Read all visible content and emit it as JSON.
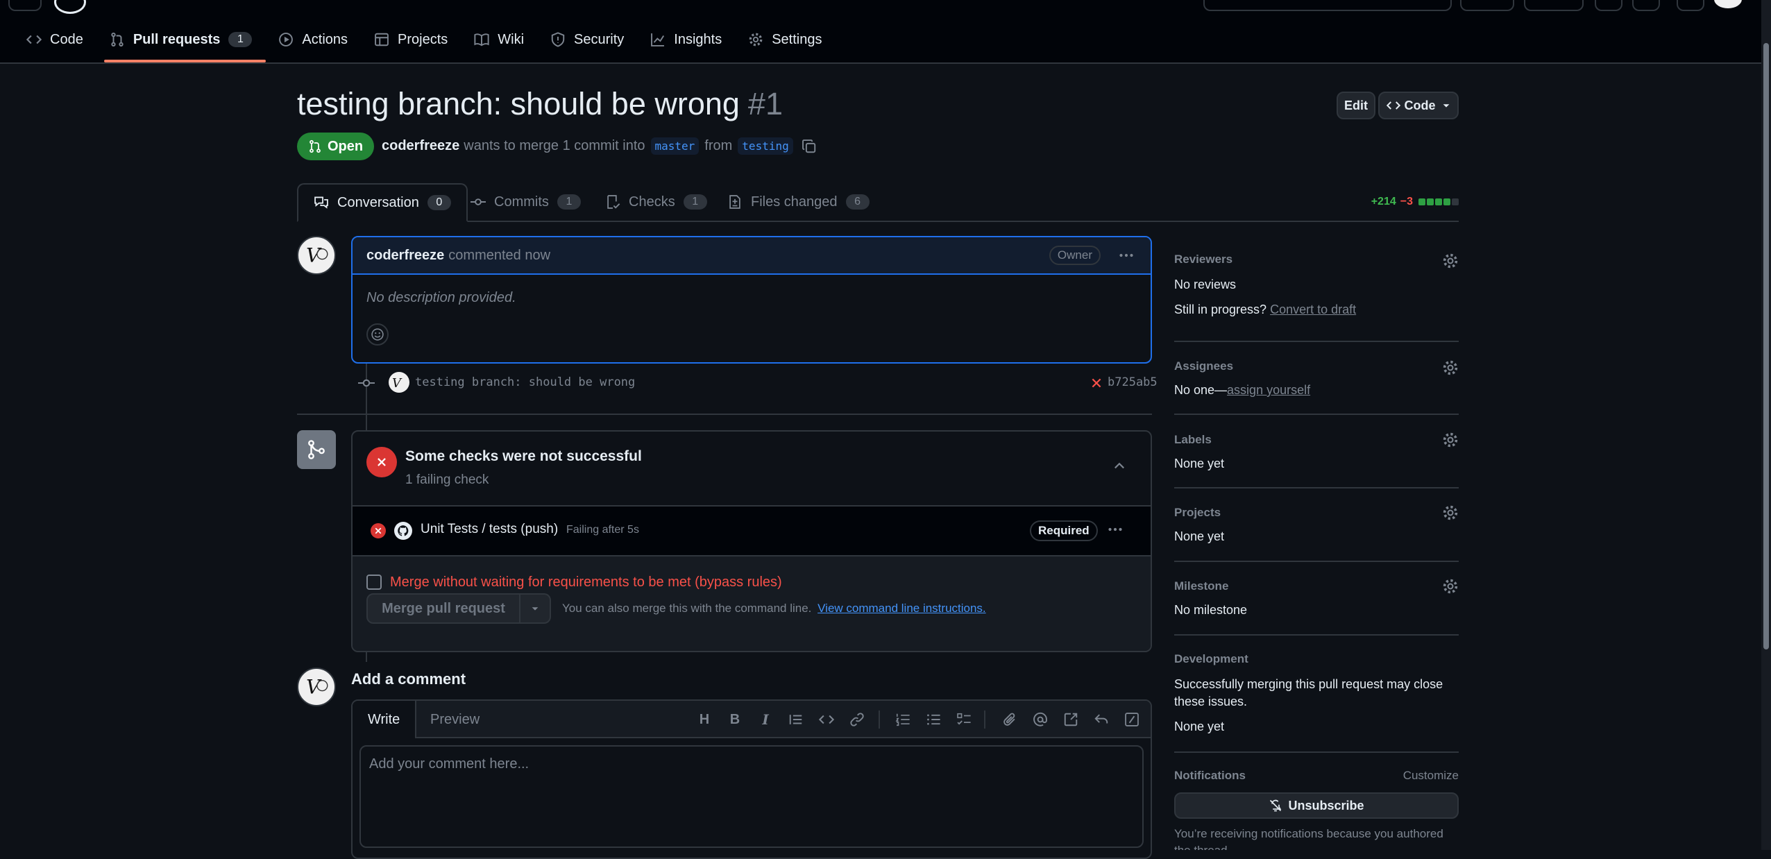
{
  "repo_nav": {
    "items": [
      {
        "label": "Code",
        "icon": "code-icon"
      },
      {
        "label": "Pull requests",
        "icon": "git-pull-request-icon",
        "count": "1"
      },
      {
        "label": "Actions",
        "icon": "play-icon"
      },
      {
        "label": "Projects",
        "icon": "table-icon"
      },
      {
        "label": "Wiki",
        "icon": "book-icon"
      },
      {
        "label": "Security",
        "icon": "shield-icon"
      },
      {
        "label": "Insights",
        "icon": "graph-icon"
      },
      {
        "label": "Settings",
        "icon": "gear-icon"
      }
    ]
  },
  "header": {
    "title": "testing branch: should be wrong",
    "number": "#1",
    "edit_label": "Edit",
    "code_label": "Code",
    "state": "Open",
    "author": "coderfreeze",
    "merge_text": "wants to merge 1 commit into",
    "base_branch": "master",
    "from_text": "from",
    "head_branch": "testing"
  },
  "tabs": [
    {
      "label": "Conversation",
      "count": "0"
    },
    {
      "label": "Commits",
      "count": "1"
    },
    {
      "label": "Checks",
      "count": "1"
    },
    {
      "label": "Files changed",
      "count": "6"
    }
  ],
  "diffstat": {
    "additions": "+214",
    "deletions": "−3"
  },
  "comment": {
    "author": "coderfreeze",
    "action": "commented now",
    "role": "Owner",
    "body": "No description provided."
  },
  "commit": {
    "message": "testing branch: should be wrong",
    "sha": "b725ab5"
  },
  "checks": {
    "title": "Some checks were not successful",
    "subtitle": "1 failing check",
    "item_name": "Unit Tests / tests (push)",
    "item_status": "Failing after 5s",
    "item_badge": "Required"
  },
  "merge": {
    "bypass_label": "Merge without waiting for requirements to be met (bypass rules)",
    "button_label": "Merge pull request",
    "hint_text": "You can also merge this with the command line.",
    "hint_link": "View command line instructions."
  },
  "composer": {
    "heading": "Add a comment",
    "write_tab": "Write",
    "preview_tab": "Preview",
    "placeholder": "Add your comment here..."
  },
  "sidebar": {
    "reviewers_title": "Reviewers",
    "reviewers_value": "No reviews",
    "draft_prefix": "Still in progress?",
    "draft_link": "Convert to draft",
    "assignees_title": "Assignees",
    "assignees_prefix": "No one—",
    "assignees_link": "assign yourself",
    "labels_title": "Labels",
    "labels_value": "None yet",
    "projects_title": "Projects",
    "projects_value": "None yet",
    "milestone_title": "Milestone",
    "milestone_value": "No milestone",
    "development_title": "Development",
    "development_text": "Successfully merging this pull request may close these issues.",
    "development_value": "None yet",
    "notifications_title": "Notifications",
    "customize_label": "Customize",
    "unsubscribe_label": "Unsubscribe",
    "notification_reason": "You’re receiving notifications because you authored the thread."
  },
  "colors": {
    "background": "#0d1117",
    "accent_blue": "#4493f8",
    "success_green": "#238636",
    "danger_red": "#da3633",
    "danger_text": "#f85149",
    "tab_underline": "#f78166"
  }
}
